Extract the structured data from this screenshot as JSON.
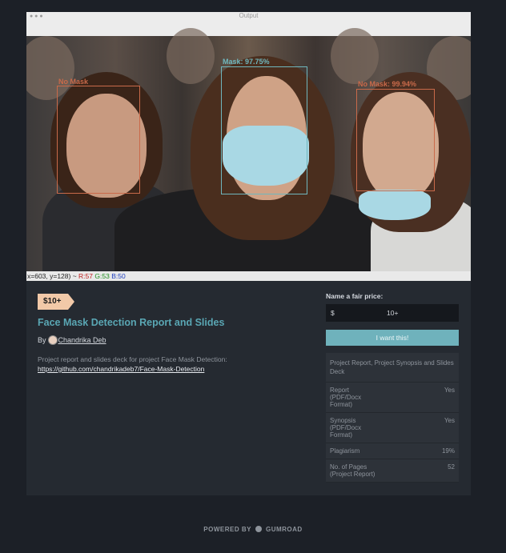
{
  "image": {
    "window_title": "Output",
    "status": {
      "prefix": "x=603, y=128) ~ ",
      "r": "R:57",
      "g": "G:53",
      "b": "B:50"
    },
    "labels": {
      "left": "No Mask",
      "center": "Mask: 97.75%",
      "right": "No Mask: 99.94%"
    },
    "colors": {
      "no_mask_box": "#c96a4a",
      "mask_box": "#6fb7be"
    }
  },
  "product": {
    "price_tag": "$10+",
    "title": "Face Mask Detection Report and Slides",
    "by": "By",
    "author": "Chandrika Deb",
    "description": "Project report and slides deck for project Face Mask Detection:",
    "link": "https://github.com/chandrikadeb7/Face-Mask-Detection"
  },
  "purchase": {
    "fair_price_label": "Name a fair price:",
    "currency": "$",
    "price_placeholder": "10+",
    "button": "I want this!"
  },
  "specs": {
    "heading": "Project Report, Project Synopsis and Slides Deck",
    "rows": [
      {
        "key": "Report (PDF/Docx Format)",
        "value": "Yes"
      },
      {
        "key": "Synopsis (PDF/Docx Format)",
        "value": "Yes"
      },
      {
        "key": "Plagiarism",
        "value": "19%"
      },
      {
        "key": "No. of Pages (Project Report)",
        "value": "52"
      }
    ]
  },
  "footer": {
    "powered": "POWERED BY",
    "brand": "GUMROAD"
  },
  "theme": {
    "accent": "#5aa7b4",
    "button": "#6fb2bc",
    "tag": "#f2c9a8",
    "background": "#1c2027"
  }
}
